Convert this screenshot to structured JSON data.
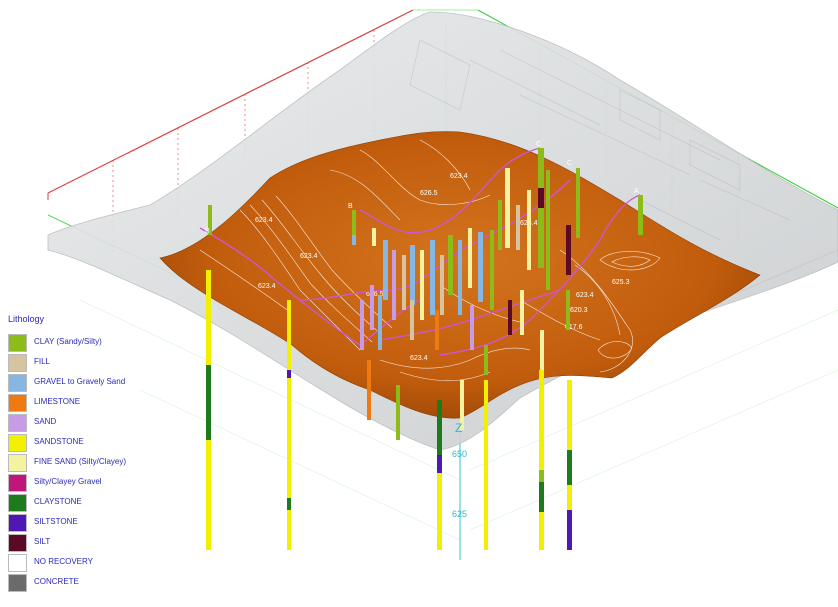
{
  "legend": {
    "title": "Lithology",
    "items": [
      {
        "label": "CLAY (Sandy/Silty)",
        "color": "#8dbb1a"
      },
      {
        "label": "FILL",
        "color": "#d6c3a0"
      },
      {
        "label": "GRAVEL to Gravely Sand",
        "color": "#86b7e2"
      },
      {
        "label": "LIMESTONE",
        "color": "#f07a12"
      },
      {
        "label": "SAND",
        "color": "#c79be6"
      },
      {
        "label": "SANDSTONE",
        "color": "#f2ef00"
      },
      {
        "label": "FINE SAND (Silty/Clayey)",
        "color": "#f3f3a2"
      },
      {
        "label": "Silty/Clayey Gravel",
        "color": "#c0157a"
      },
      {
        "label": "CLAYSTONE",
        "color": "#1d7a1d"
      },
      {
        "label": "SILTSTONE",
        "color": "#4e18b5"
      },
      {
        "label": "SILT",
        "color": "#5b0a26"
      },
      {
        "label": "NO RECOVERY",
        "color": "#ffffff"
      },
      {
        "label": "CONCRETE",
        "color": "#6b6b6b"
      }
    ]
  },
  "contours": [
    "623.4",
    "626.5",
    "623.4",
    "620.3",
    "617.6",
    "623.4",
    "623.4",
    "626.5",
    "623.4",
    "623.4",
    "623.4",
    "625.3"
  ],
  "axis": {
    "label": "Z",
    "ticks": [
      "650",
      "625"
    ]
  },
  "boreholes": [
    "B",
    "C",
    "C",
    "A",
    "B"
  ],
  "colors": {
    "surface": "#c8620f",
    "terrain": "#d9dcdd",
    "bounding_red": "#d94040",
    "bounding_green": "#33cc33",
    "axis_cyan": "#33c4d6",
    "fence": "#cc55dd"
  }
}
